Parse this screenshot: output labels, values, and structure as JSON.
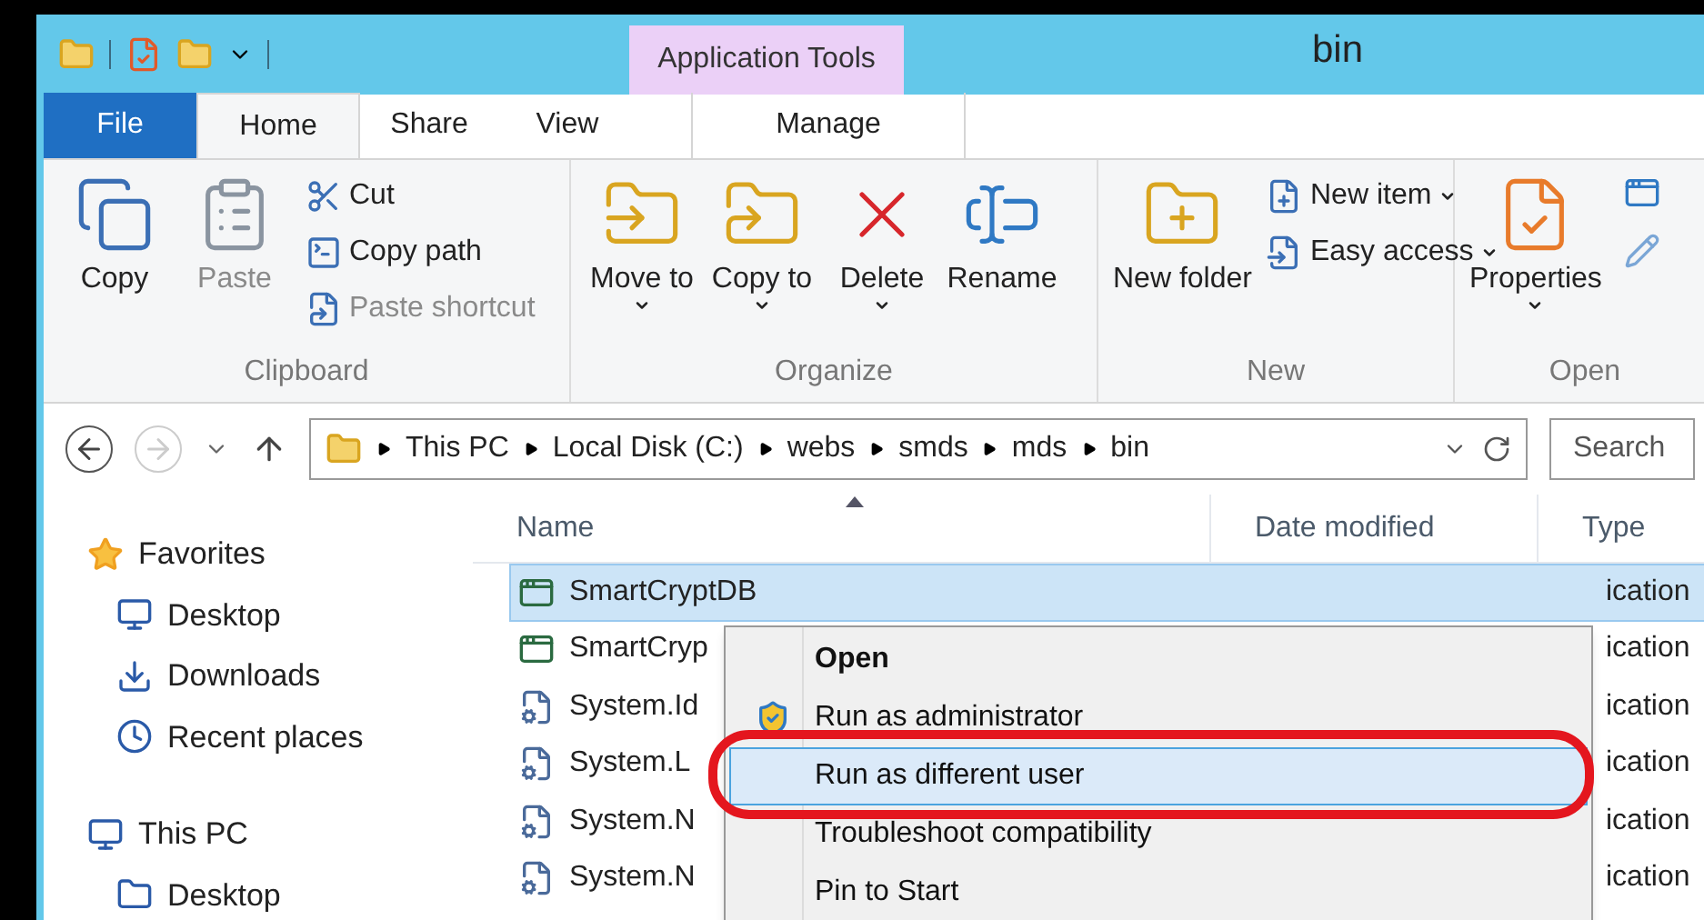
{
  "window": {
    "title": "bin"
  },
  "context_tab": {
    "label": "Application Tools"
  },
  "tabs": [
    {
      "label": "File",
      "kind": "file",
      "selected": false
    },
    {
      "label": "Home",
      "kind": "tab",
      "selected": true
    },
    {
      "label": "Share",
      "kind": "tab",
      "selected": false
    },
    {
      "label": "View",
      "kind": "tab",
      "selected": false
    },
    {
      "label": "Manage",
      "kind": "contextual",
      "selected": false
    }
  ],
  "ribbon": {
    "groups": [
      {
        "label": "Clipboard",
        "large": [
          {
            "label": "Copy",
            "disabled": false,
            "dropdown": false
          },
          {
            "label": "Paste",
            "disabled": true,
            "dropdown": false
          }
        ],
        "small": [
          {
            "label": "Cut",
            "disabled": false,
            "dropdown": false
          },
          {
            "label": "Copy path",
            "disabled": false,
            "dropdown": false
          },
          {
            "label": "Paste shortcut",
            "disabled": true,
            "dropdown": false
          }
        ]
      },
      {
        "label": "Organize",
        "large": [
          {
            "label": "Move to",
            "disabled": false,
            "dropdown": true
          },
          {
            "label": "Copy to",
            "disabled": false,
            "dropdown": true
          },
          {
            "label": "Delete",
            "disabled": false,
            "dropdown": true
          },
          {
            "label": "Rename",
            "disabled": false,
            "dropdown": false
          }
        ]
      },
      {
        "label": "New",
        "large": [
          {
            "label": "New folder",
            "disabled": false,
            "dropdown": false
          }
        ],
        "small": [
          {
            "label": "New item",
            "disabled": false,
            "dropdown": true
          },
          {
            "label": "Easy access",
            "disabled": false,
            "dropdown": true
          }
        ]
      },
      {
        "label": "Open",
        "large": [
          {
            "label": "Properties",
            "disabled": false,
            "dropdown": true
          }
        ]
      }
    ]
  },
  "address": {
    "segments": [
      "This PC",
      "Local Disk (C:)",
      "webs",
      "smds",
      "mds",
      "bin"
    ],
    "search_placeholder": "Search"
  },
  "navigation": [
    {
      "label": "Favorites",
      "children": [
        {
          "label": "Desktop"
        },
        {
          "label": "Downloads"
        },
        {
          "label": "Recent places"
        }
      ]
    },
    {
      "label": "This PC",
      "children": [
        {
          "label": "Desktop"
        }
      ]
    }
  ],
  "file_list": {
    "columns": [
      "Name",
      "Date modified",
      "Type"
    ],
    "rows": [
      {
        "name": "SmartCryptDB",
        "type": "ication",
        "selected": true
      },
      {
        "name": "SmartCryp",
        "type": "ication",
        "selected": false
      },
      {
        "name": "System.Id",
        "type": "ication",
        "selected": false
      },
      {
        "name": "System.L",
        "type": "ication",
        "selected": false
      },
      {
        "name": "System.N",
        "type": "ication",
        "selected": false
      },
      {
        "name": "System.N",
        "type": "ication",
        "selected": false
      }
    ]
  },
  "context_menu": {
    "items": [
      {
        "label": "Open",
        "kind": "default",
        "selected": false
      },
      {
        "label": "Run as administrator",
        "kind": "shield",
        "selected": false
      },
      {
        "label": "Run as different user",
        "kind": "plain",
        "selected": true
      },
      {
        "label": "Troubleshoot compatibility",
        "kind": "plain",
        "selected": false
      },
      {
        "label": "Pin to Start",
        "kind": "plain",
        "selected": false
      }
    ]
  }
}
